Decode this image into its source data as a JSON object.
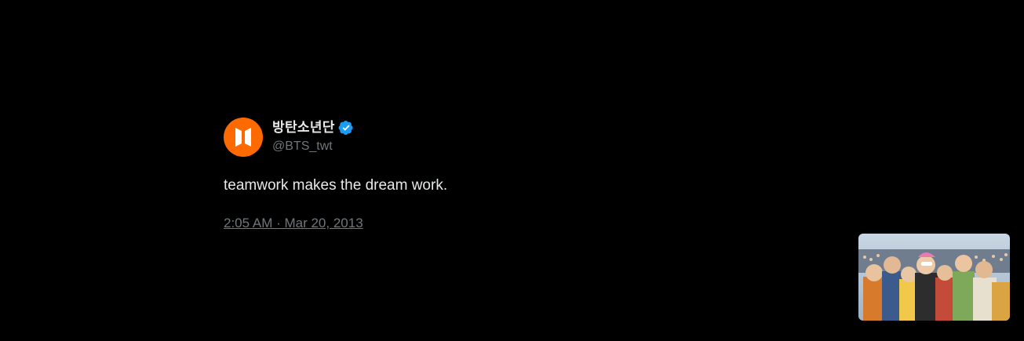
{
  "tweet": {
    "display_name": "방탄소년단",
    "handle": "@BTS_twt",
    "text": "teamwork makes the dream work.",
    "timestamp": "2:05 AM · Mar 20, 2013",
    "verified": true
  },
  "avatar": {
    "icon": "bts-logo-icon",
    "background_color": "#ff6a00"
  },
  "verified_badge": {
    "icon": "verified-badge-icon",
    "color": "#1d9bf0"
  },
  "media_thumbnail": {
    "icon": "group-photo-thumbnail"
  },
  "colors": {
    "background": "#000000",
    "primary_text": "#e7e9ea",
    "secondary_text": "#71767b"
  }
}
